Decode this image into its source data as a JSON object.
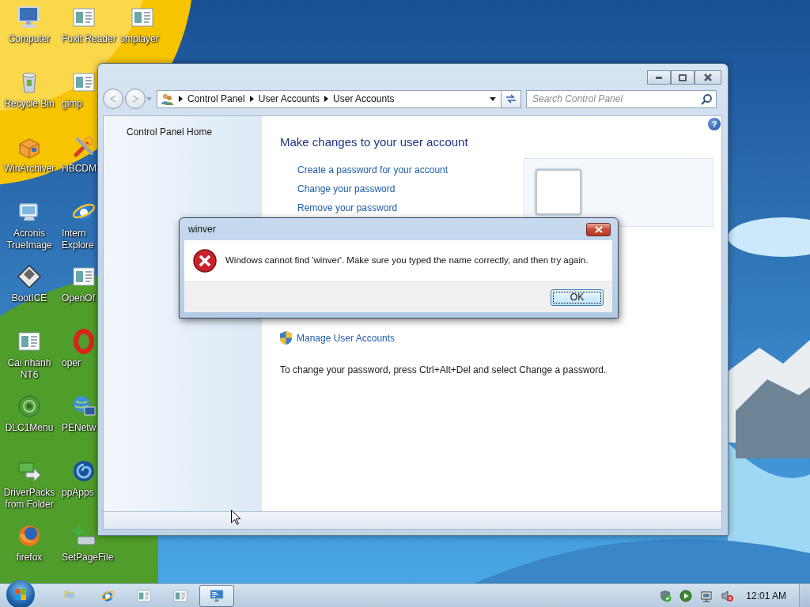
{
  "desktop_columns": [
    [
      {
        "label": "Computer",
        "kind": "computer"
      },
      {
        "label": "Recycle Bin",
        "kind": "bin"
      },
      {
        "label": "WinArchiver",
        "kind": "archive"
      },
      {
        "label": "Acronis\nTrueImage",
        "kind": "monitor"
      },
      {
        "label": "BootICE",
        "kind": "floppy"
      },
      {
        "label": "Cai nhanh\nNT6",
        "kind": "doc"
      },
      {
        "label": "DLC1Menu",
        "kind": "disc"
      },
      {
        "label": "DriverPacks\nfrom Folder",
        "kind": "arrows"
      },
      {
        "label": "firefox",
        "kind": "firefox"
      }
    ],
    [
      {
        "label": "Foxit Reader",
        "kind": "doc"
      },
      {
        "label": "gimp",
        "kind": "doc"
      },
      {
        "label": "HBCDM",
        "kind": "tools"
      },
      {
        "label": "Intern\nExplore",
        "kind": "ie"
      },
      {
        "label": "OpenOf",
        "kind": "doc"
      },
      {
        "label": "oper",
        "kind": "opera"
      },
      {
        "label": "PENetw",
        "kind": "network"
      },
      {
        "label": "ppApps",
        "kind": "swirl"
      },
      {
        "label": "SetPageFile",
        "kind": "setpage"
      }
    ],
    [
      {
        "label": "smplayer",
        "kind": "doc"
      }
    ]
  ],
  "window": {
    "breadcrumb": [
      "Control Panel",
      "User Accounts",
      "User Accounts"
    ],
    "search": {
      "placeholder": "Search Control Panel"
    },
    "sidebar": {
      "items": [
        {
          "label": "Control Panel Home"
        }
      ]
    },
    "help": "?",
    "heading": "Make changes to your user account",
    "tasks": [
      {
        "label": "Create a password for your account"
      },
      {
        "label": "Change your password"
      },
      {
        "label": "Remove your password"
      }
    ],
    "manage_link": "Manage User Accounts",
    "note": "To change your password, press Ctrl+Alt+Del and select Change a password."
  },
  "dialog": {
    "title": "winver",
    "message": "Windows cannot find 'winver'. Make sure you typed the name correctly, and then try again.",
    "button": {
      "label": "OK",
      "focused": true
    }
  },
  "taskbar": {
    "items": [
      {
        "kind": "folder",
        "active": false
      },
      {
        "kind": "ie",
        "active": false
      },
      {
        "kind": "doc",
        "active": false
      },
      {
        "kind": "doc",
        "active": false
      },
      {
        "kind": "app",
        "active": true
      }
    ],
    "tray": [
      {
        "kind": "shield"
      },
      {
        "kind": "play"
      },
      {
        "kind": "network"
      },
      {
        "kind": "speaker"
      }
    ],
    "clock": "12:01 AM"
  }
}
